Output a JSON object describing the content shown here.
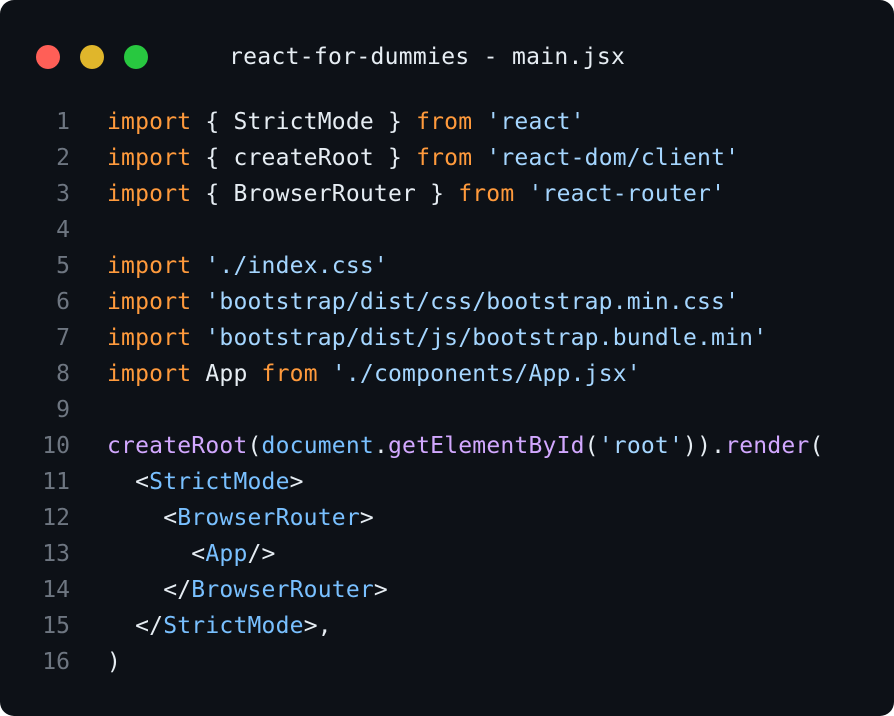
{
  "window": {
    "title": "react-for-dummies - main.jsx",
    "controls": [
      {
        "name": "close-button",
        "color": "#ff5f57"
      },
      {
        "name": "minimize-button",
        "color": "#e0b62b"
      },
      {
        "name": "maximize-button",
        "color": "#28c840"
      }
    ]
  },
  "theme": {
    "background": "#0d1117",
    "line_number": "#6e7681",
    "default": "#e6edf3",
    "keyword": "#ff9a3c",
    "string": "#a5d6ff",
    "function": "#d2a8ff",
    "variable": "#79c0ff"
  },
  "editor": {
    "lines": [
      {
        "num": "1",
        "tokens": [
          [
            "kw",
            "import"
          ],
          [
            "pl",
            " { StrictMode } "
          ],
          [
            "kw",
            "from"
          ],
          [
            "pl",
            " "
          ],
          [
            "str",
            "'react'"
          ]
        ]
      },
      {
        "num": "2",
        "tokens": [
          [
            "kw",
            "import"
          ],
          [
            "pl",
            " { createRoot } "
          ],
          [
            "kw",
            "from"
          ],
          [
            "pl",
            " "
          ],
          [
            "str",
            "'react-dom/client'"
          ]
        ]
      },
      {
        "num": "3",
        "tokens": [
          [
            "kw",
            "import"
          ],
          [
            "pl",
            " { BrowserRouter } "
          ],
          [
            "kw",
            "from"
          ],
          [
            "pl",
            " "
          ],
          [
            "str",
            "'react-router'"
          ]
        ]
      },
      {
        "num": "4",
        "tokens": []
      },
      {
        "num": "5",
        "tokens": [
          [
            "kw",
            "import"
          ],
          [
            "pl",
            " "
          ],
          [
            "str",
            "'./index.css'"
          ]
        ]
      },
      {
        "num": "6",
        "tokens": [
          [
            "kw",
            "import"
          ],
          [
            "pl",
            " "
          ],
          [
            "str",
            "'bootstrap/dist/css/bootstrap.min.css'"
          ]
        ]
      },
      {
        "num": "7",
        "tokens": [
          [
            "kw",
            "import"
          ],
          [
            "pl",
            " "
          ],
          [
            "str",
            "'bootstrap/dist/js/bootstrap.bundle.min'"
          ]
        ]
      },
      {
        "num": "8",
        "tokens": [
          [
            "kw",
            "import"
          ],
          [
            "pl",
            " App "
          ],
          [
            "kw",
            "from"
          ],
          [
            "pl",
            " "
          ],
          [
            "str",
            "'./components/App.jsx'"
          ]
        ]
      },
      {
        "num": "9",
        "tokens": []
      },
      {
        "num": "10",
        "tokens": [
          [
            "fn",
            "createRoot"
          ],
          [
            "pl",
            "("
          ],
          [
            "var",
            "document"
          ],
          [
            "pl",
            "."
          ],
          [
            "fn",
            "getElementById"
          ],
          [
            "pl",
            "("
          ],
          [
            "str",
            "'root'"
          ],
          [
            "pl",
            "))."
          ],
          [
            "fn",
            "render"
          ],
          [
            "pl",
            "("
          ]
        ]
      },
      {
        "num": "11",
        "tokens": [
          [
            "pl",
            "  <"
          ],
          [
            "var",
            "StrictMode"
          ],
          [
            "pl",
            ">"
          ]
        ]
      },
      {
        "num": "12",
        "tokens": [
          [
            "pl",
            "    <"
          ],
          [
            "var",
            "BrowserRouter"
          ],
          [
            "pl",
            ">"
          ]
        ]
      },
      {
        "num": "13",
        "tokens": [
          [
            "pl",
            "      <"
          ],
          [
            "var",
            "App"
          ],
          [
            "pl",
            "/>"
          ]
        ]
      },
      {
        "num": "14",
        "tokens": [
          [
            "pl",
            "    </"
          ],
          [
            "var",
            "BrowserRouter"
          ],
          [
            "pl",
            ">"
          ]
        ]
      },
      {
        "num": "15",
        "tokens": [
          [
            "pl",
            "  </"
          ],
          [
            "var",
            "StrictMode"
          ],
          [
            "pl",
            ">,"
          ]
        ]
      },
      {
        "num": "16",
        "tokens": [
          [
            "pl",
            ")"
          ]
        ]
      }
    ]
  }
}
